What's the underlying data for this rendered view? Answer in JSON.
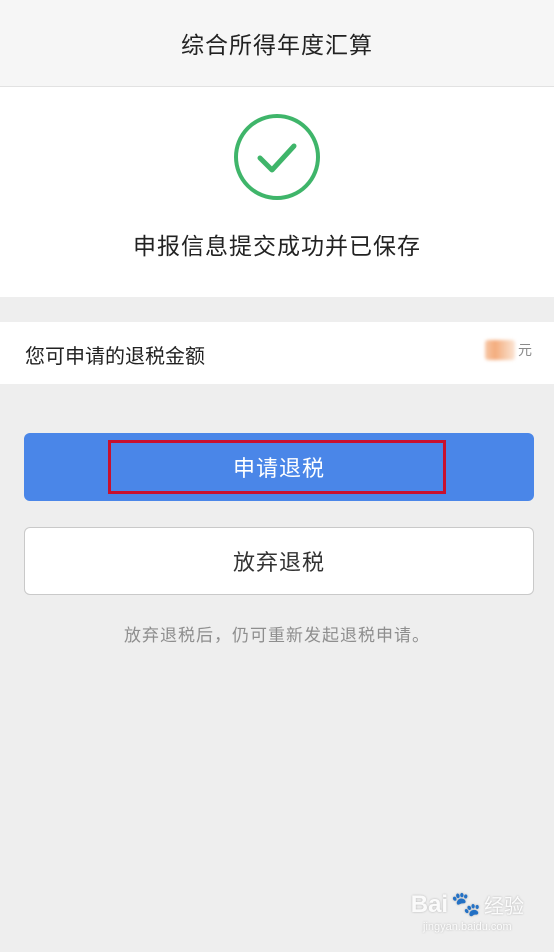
{
  "header": {
    "title": "综合所得年度汇算"
  },
  "success": {
    "icon": "check-circle-icon",
    "message": "申报信息提交成功并已保存",
    "accent_color": "#3fb56a"
  },
  "refund": {
    "label": "您可申请的退税金额",
    "unit": "元"
  },
  "actions": {
    "apply_label": "申请退税",
    "apply_color": "#4a86e8",
    "abandon_label": "放弃退税"
  },
  "hint": "放弃退税后，仍可重新发起退税申请。",
  "annotation": {
    "highlight_color": "#c8102e"
  },
  "watermark": {
    "logo": "Bai",
    "logo_suffix": "经验",
    "url": "jingyan.baidu.com"
  }
}
